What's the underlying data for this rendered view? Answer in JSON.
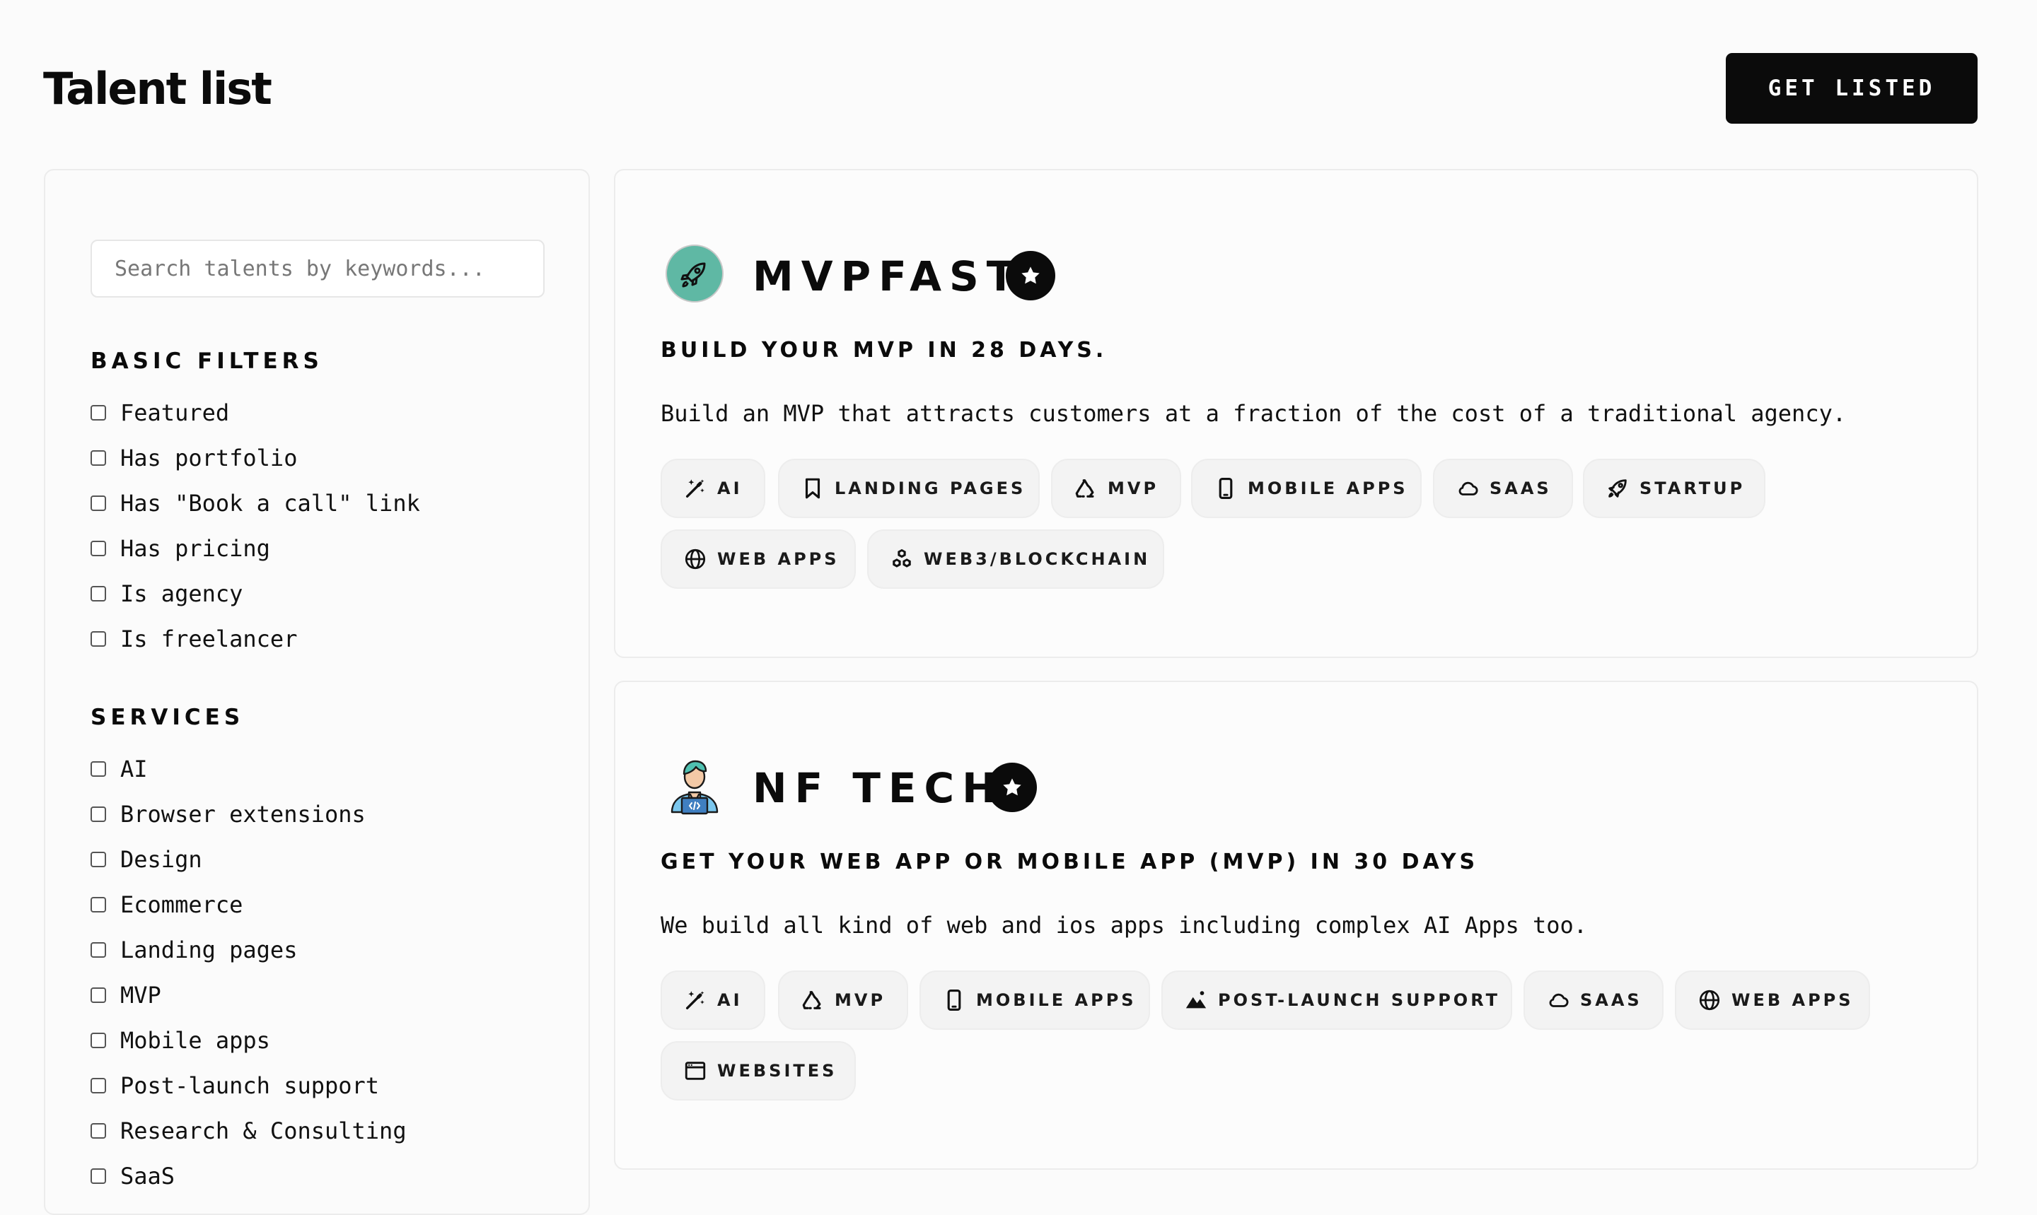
{
  "header": {
    "title": "Talent list",
    "cta_label": "GET LISTED"
  },
  "sidebar": {
    "search": {
      "placeholder": "Search talents by keywords...",
      "value": ""
    },
    "basic_filters": {
      "heading": "BASIC FILTERS",
      "items": [
        "Featured",
        "Has portfolio",
        "Has \"Book a call\" link",
        "Has pricing",
        "Is agency",
        "Is freelancer"
      ]
    },
    "services": {
      "heading": "SERVICES",
      "items": [
        "AI",
        "Browser extensions",
        "Design",
        "Ecommerce",
        "Landing pages",
        "MVP",
        "Mobile apps",
        "Post-launch support",
        "Research & Consulting",
        "SaaS"
      ]
    }
  },
  "colors": {
    "accent_teal": "#5fb8a4",
    "ink": "#0b0b0b",
    "tag_bg": "#f3f3f3"
  },
  "talents": [
    {
      "name": "MVPFAST",
      "logo_icon": "rocket-icon",
      "featured_icon": "star-icon",
      "tagline": "BUILD YOUR MVP IN 28 DAYS.",
      "description": "Build an MVP that attracts customers at a fraction of the cost of a traditional agency.",
      "tags": [
        {
          "label": "AI",
          "icon": "magic-wand-icon"
        },
        {
          "label": "LANDING PAGES",
          "icon": "bookmark-icon"
        },
        {
          "label": "MVP",
          "icon": "recycle-icon"
        },
        {
          "label": "MOBILE APPS",
          "icon": "smartphone-icon"
        },
        {
          "label": "SAAS",
          "icon": "cloud-icon"
        },
        {
          "label": "STARTUP",
          "icon": "rocket-icon"
        },
        {
          "label": "WEB APPS",
          "icon": "globe-icon"
        },
        {
          "label": "WEB3/BLOCKCHAIN",
          "icon": "cubes-icon"
        }
      ]
    },
    {
      "name": "NF TECH",
      "logo_icon": "developer-avatar-icon",
      "featured_icon": "star-icon",
      "tagline": "GET YOUR WEB APP OR MOBILE APP (MVP) IN 30 DAYS",
      "description": "We build all kind of web and ios apps including complex AI Apps too.",
      "tags": [
        {
          "label": "AI",
          "icon": "magic-wand-icon"
        },
        {
          "label": "MVP",
          "icon": "recycle-icon"
        },
        {
          "label": "MOBILE APPS",
          "icon": "smartphone-icon"
        },
        {
          "label": "POST-LAUNCH SUPPORT",
          "icon": "mountain-icon"
        },
        {
          "label": "SAAS",
          "icon": "cloud-icon"
        },
        {
          "label": "WEB APPS",
          "icon": "globe-icon"
        },
        {
          "label": "WEBSITES",
          "icon": "browser-window-icon"
        }
      ]
    }
  ]
}
